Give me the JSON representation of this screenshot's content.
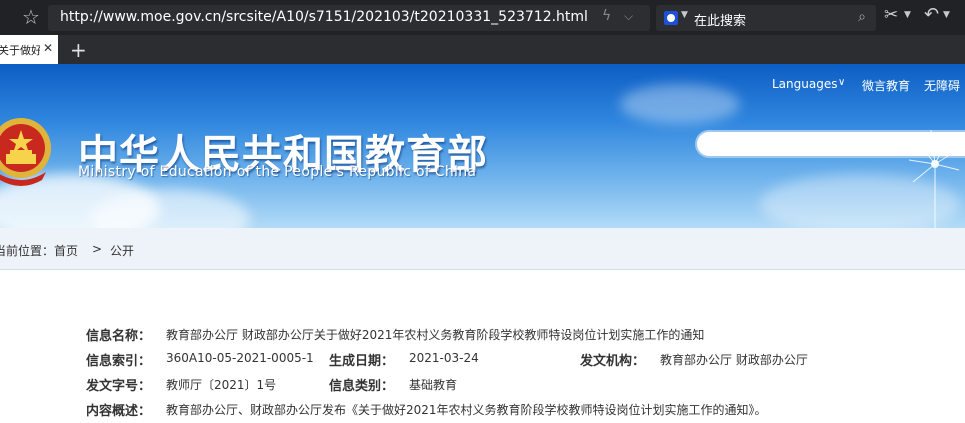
{
  "browser": {
    "url": "http://www.moe.gov.cn/srcsite/A10/s7151/202103/t20210331_523712.html",
    "search_placeholder": "在此搜索",
    "tab_label": "关于做好",
    "tab_close": "✕",
    "new_tab": "+"
  },
  "header": {
    "languages": "Languages",
    "weiyan": "微言教育",
    "accessibility": "无障碍",
    "title_cn": "中华人民共和国教育部",
    "title_en": "Ministry of Education of the People's Republic of China"
  },
  "breadcrumb": {
    "prefix": "当前位置：",
    "home": "首页",
    "sep": ">",
    "current": "公开"
  },
  "info": {
    "name_label": "信息名称：",
    "name_value": "教育部办公厅 财政部办公厅关于做好2021年农村义务教育阶段学校教师特设岗位计划实施工作的通知",
    "index_label": "信息索引：",
    "index_value": "360A10-05-2021-0005-1",
    "date_label": "生成日期：",
    "date_value": "2021-03-24",
    "org_label": "发文机构：",
    "org_value": "教育部办公厅 财政部办公厅",
    "docno_label": "发文字号：",
    "docno_value": "教师厅〔2021〕1号",
    "category_label": "信息类别：",
    "category_value": "基础教育",
    "summary_label": "内容概述：",
    "summary_value": "教育部办公厅、财政部办公厅发布《关于做好2021年农村义务教育阶段学校教师特设岗位计划实施工作的通知》。"
  },
  "colors": {
    "banner_top": "#0d5ec4",
    "banner_bottom": "#b3dbf7",
    "chrome_dark": "#202225"
  },
  "icons": [
    "star-icon",
    "bolt-icon",
    "chevron-down-icon",
    "search-engine-icon",
    "search-icon",
    "scissors-icon",
    "undo-icon",
    "close-icon",
    "plus-icon",
    "national-emblem-icon",
    "dandelion-icon"
  ]
}
